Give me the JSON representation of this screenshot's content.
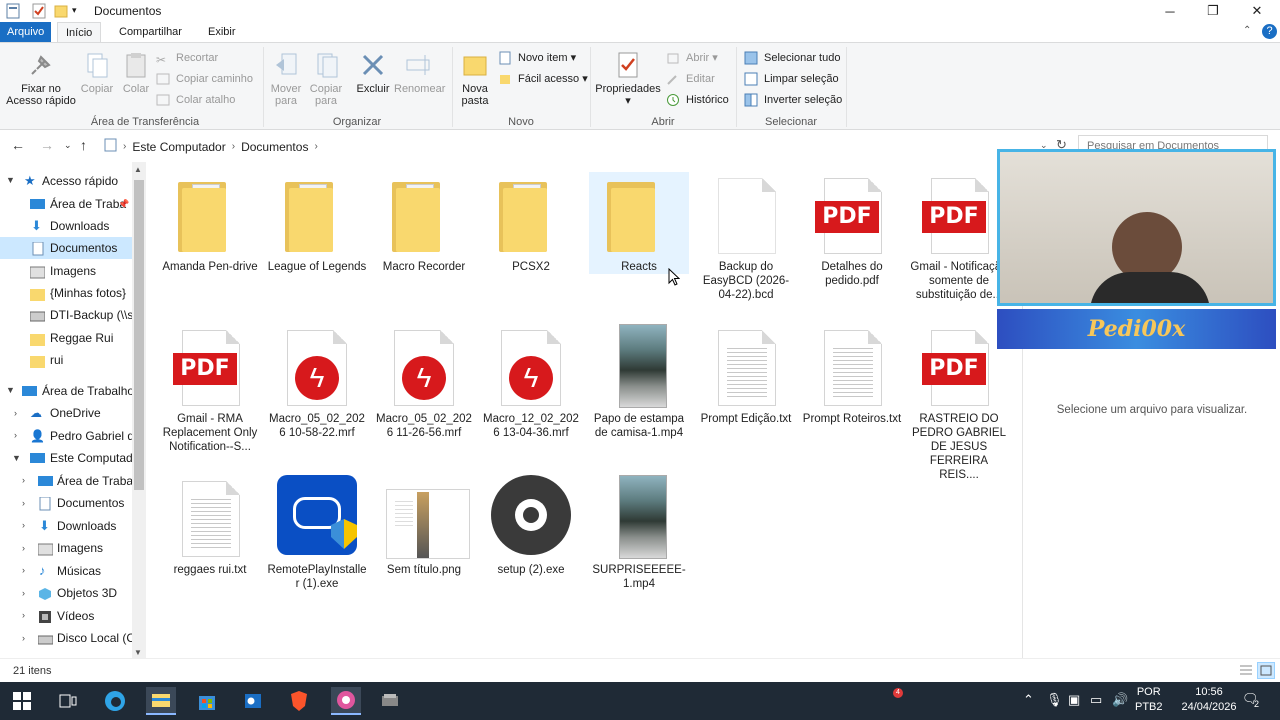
{
  "window": {
    "title": "Documentos"
  },
  "tabs": [
    "Arquivo",
    "Início",
    "Compartilhar",
    "Exibir"
  ],
  "ribbon": {
    "clipboard": {
      "pin": "Fixar no Acesso rápido",
      "copy": "Copiar",
      "paste": "Colar",
      "cut": "Recortar",
      "copy_path": "Copiar caminho",
      "paste_shortcut": "Colar atalho",
      "label": "Área de Transferência"
    },
    "organize": {
      "move": "Mover para",
      "copy_to": "Copiar para",
      "delete": "Excluir",
      "rename": "Renomear",
      "label": "Organizar"
    },
    "new": {
      "new_folder": "Nova pasta",
      "new_item": "Novo item",
      "easy_access": "Fácil acesso",
      "label": "Novo"
    },
    "open": {
      "properties": "Propriedades",
      "open": "Abrir",
      "edit": "Editar",
      "history": "Histórico",
      "label": "Abrir"
    },
    "select": {
      "select_all": "Selecionar tudo",
      "clear": "Limpar seleção",
      "invert": "Inverter seleção",
      "label": "Selecionar"
    }
  },
  "address": {
    "crumbs": [
      "Este Computador",
      "Documentos"
    ]
  },
  "search": {
    "placeholder": "Pesquisar em Documentos"
  },
  "nav": {
    "quick_access": "Acesso rápido",
    "items": [
      "Área de Traba",
      "Downloads",
      "Documentos",
      "Imagens",
      "{Minhas fotos}",
      "DTI-Backup (\\\\se",
      "Reggae Rui",
      "rui"
    ],
    "workspace": "Área de Trabalho",
    "workspace_items": [
      "OneDrive",
      "Pedro Gabriel de",
      "Este Computado"
    ],
    "computer_items": [
      "Área de Trabalh",
      "Documentos",
      "Downloads",
      "Imagens",
      "Músicas",
      "Objetos 3D",
      "Vídeos",
      "Disco Local (C:"
    ]
  },
  "files": [
    {
      "name": "Amanda Pen-drive",
      "type": "folder"
    },
    {
      "name": "League of Legends",
      "type": "folder"
    },
    {
      "name": "Macro Recorder",
      "type": "folder"
    },
    {
      "name": "PCSX2",
      "type": "folder"
    },
    {
      "name": "Reacts",
      "type": "folder"
    },
    {
      "name": "Backup do EasyBCD (2026-04-22).bcd",
      "type": "blank"
    },
    {
      "name": "Detalhes do pedido.pdf",
      "type": "pdf"
    },
    {
      "name": "Gmail - Notificação somente de substituição de...",
      "type": "pdf"
    },
    {
      "name": "Gmail - RMA Replacement Only Notification--S...",
      "type": "pdf"
    },
    {
      "name": "Macro_05_02_2026 10-58-22.mrf",
      "type": "mrf"
    },
    {
      "name": "Macro_05_02_2026 11-26-56.mrf",
      "type": "mrf"
    },
    {
      "name": "Macro_12_02_2026 13-04-36.mrf",
      "type": "mrf"
    },
    {
      "name": "Papo de estampa de camisa-1.mp4",
      "type": "video"
    },
    {
      "name": "Prompt Edição.txt",
      "type": "txt"
    },
    {
      "name": "Prompt Roteiros.txt",
      "type": "txt"
    },
    {
      "name": "RASTREIO DO PEDRO GABRIEL DE JESUS FERREIRA REIS....",
      "type": "pdf"
    },
    {
      "name": "reggaes rui.txt",
      "type": "txt"
    },
    {
      "name": "RemotePlayInstaller (1).exe",
      "type": "exe-remote"
    },
    {
      "name": "Sem título.png",
      "type": "png"
    },
    {
      "name": "setup (2).exe",
      "type": "exe-setup"
    },
    {
      "name": "SURPRISEEEEE-1.mp4",
      "type": "video"
    }
  ],
  "pdf_badge": "PDF",
  "preview": {
    "message": "Selecione um arquivo para visualizar."
  },
  "overlay": {
    "banner": "Pedi00x"
  },
  "status": {
    "count": "21 itens"
  },
  "taskbar": {
    "lang": "POR",
    "layout": "PTB2",
    "time": "10:56",
    "date": "24/04/2026",
    "notif_count": "2",
    "badge": "4"
  },
  "colors": {
    "accent": "#1a6ec4",
    "selection": "#cce8ff",
    "pdf": "#d7191c",
    "folder": "#f9d86e"
  }
}
